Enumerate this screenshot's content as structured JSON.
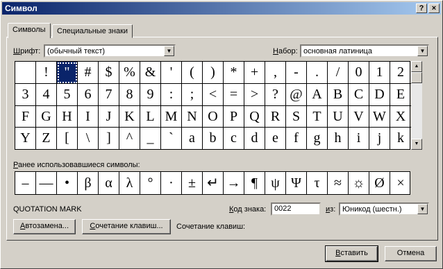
{
  "window": {
    "title": "Символ",
    "help_glyph": "?",
    "close_glyph": "×"
  },
  "tabs": [
    {
      "label": "Символы",
      "active": true
    },
    {
      "label": "Специальные знаки",
      "active": false
    }
  ],
  "font_label_mnemonic": "Ш",
  "font_label_rest": "рифт:",
  "font_value": "(обычный текст)",
  "subset_label_mnemonic": "Н",
  "subset_label_rest": "абор:",
  "subset_value": "основная латиница",
  "symbols": [
    " ",
    "!",
    "\"",
    "#",
    "$",
    "%",
    "&",
    "'",
    "(",
    ")",
    "*",
    "+",
    ",",
    "-",
    ".",
    "/",
    "0",
    "1",
    "2",
    "3",
    "4",
    "5",
    "6",
    "7",
    "8",
    "9",
    ":",
    ";",
    "<",
    "=",
    ">",
    "?",
    "@",
    "A",
    "B",
    "C",
    "D",
    "E",
    "F",
    "G",
    "H",
    "I",
    "J",
    "K",
    "L",
    "M",
    "N",
    "O",
    "P",
    "Q",
    "R",
    "S",
    "T",
    "U",
    "V",
    "W",
    "X",
    "Y",
    "Z",
    "[",
    "\\",
    "]",
    "^",
    "_",
    "`",
    "a",
    "b",
    "c",
    "d",
    "e",
    "f",
    "g",
    "h",
    "i",
    "j",
    "k"
  ],
  "selected_symbol_index": 2,
  "recent_label_mnemonic": "Р",
  "recent_label_rest": "анее использовавшиеся символы:",
  "recent_symbols": [
    "–",
    "—",
    "•",
    "β",
    "α",
    "λ",
    "°",
    "·",
    "±",
    "↵",
    "→",
    "¶",
    "ψ",
    "Ψ",
    "τ",
    "≈",
    "☼",
    "Ø",
    "×"
  ],
  "char_name": "QUOTATION MARK",
  "code_label_mnemonic": "К",
  "code_label_rest": "од знака:",
  "code_value": "0022",
  "from_label_mnemonic": "и",
  "from_label_rest": "з:",
  "from_value": "Юникод (шестн.)",
  "autocorrect_mnemonic": "А",
  "autocorrect_rest": "втозамена...",
  "shortcut_key_mnemonic": "С",
  "shortcut_key_rest": "очетание клавиш...",
  "shortcut_label": "Сочетание клавиш:",
  "insert_mnemonic": "В",
  "insert_rest": "ставить",
  "cancel_label": "Отмена",
  "dropdown_glyph": "▼",
  "scroll_up_glyph": "▲",
  "scroll_down_glyph": "▼"
}
